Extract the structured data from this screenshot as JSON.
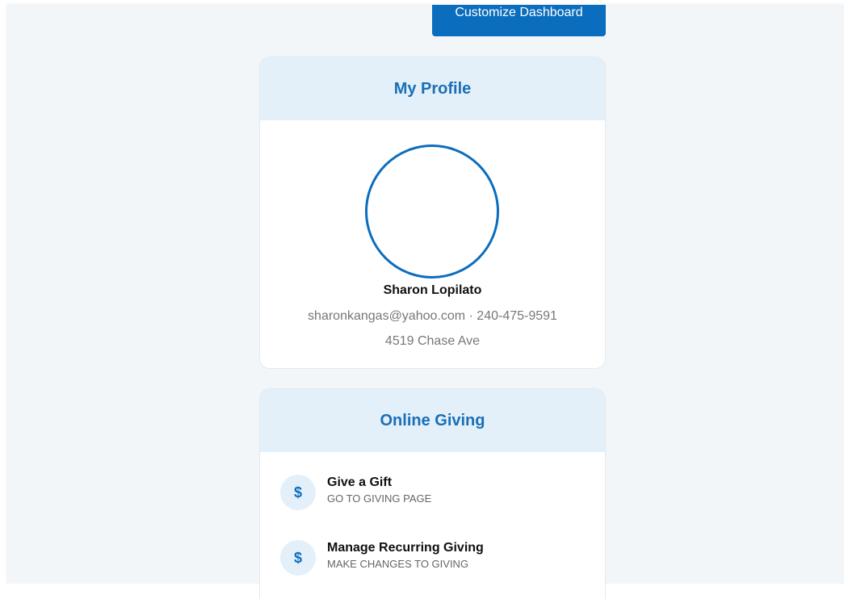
{
  "toolbar": {
    "customize_label": "Customize Dashboard"
  },
  "profile": {
    "title": "My Profile",
    "name": "Sharon Lopilato",
    "contact": "sharonkangas@yahoo.com · 240-475-9591",
    "address": "4519 Chase Ave"
  },
  "giving": {
    "title": "Online Giving",
    "items": [
      {
        "icon": "dollar-icon",
        "glyph": "$",
        "title": "Give a Gift",
        "subtitle": "GO TO GIVING PAGE"
      },
      {
        "icon": "dollar-icon",
        "glyph": "$",
        "title": "Manage Recurring Giving",
        "subtitle": "MAKE CHANGES TO GIVING"
      }
    ]
  },
  "colors": {
    "accent": "#0b6dbd",
    "header_bg": "#e3f0fa",
    "page_bg": "#f3f6f9",
    "title_text": "#1a6fb5"
  }
}
